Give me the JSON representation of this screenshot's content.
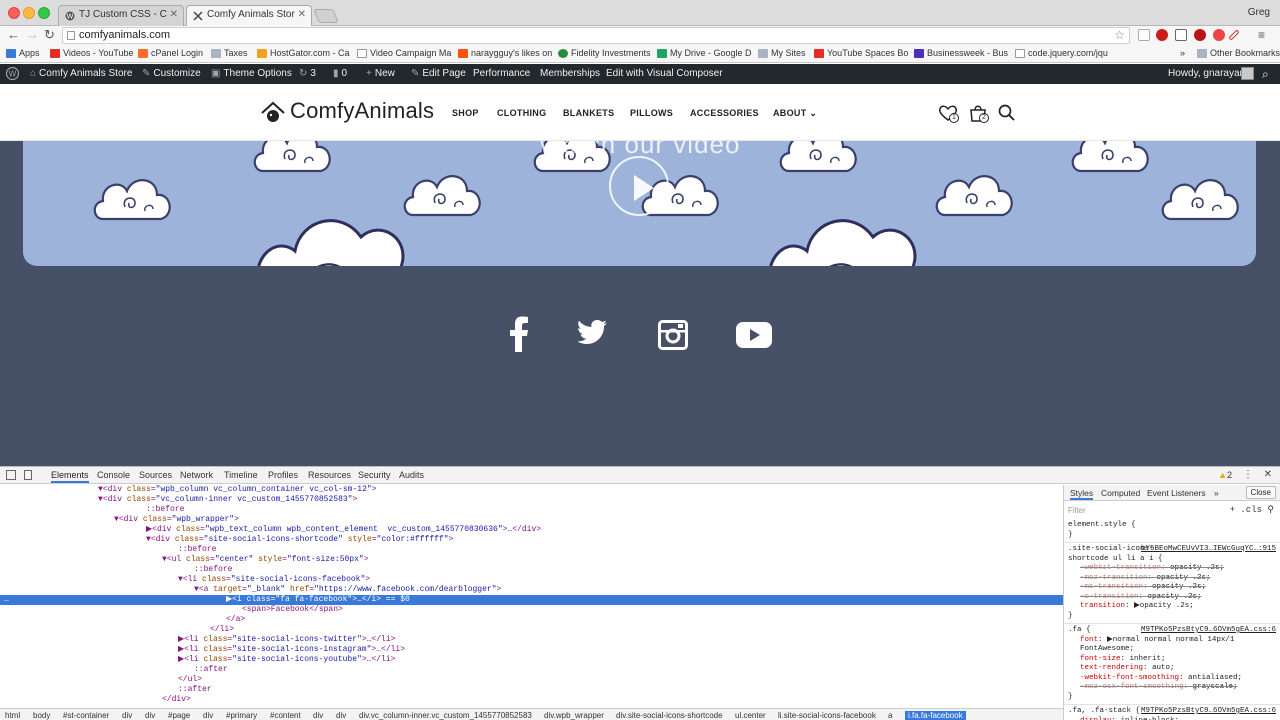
{
  "browser": {
    "tabs": [
      {
        "title": "TJ Custom CSS - Comfy A",
        "active": false
      },
      {
        "title": "Comfy Animals Store | Jus",
        "active": true
      }
    ],
    "profile": "Greg",
    "url": "comfyanimals.com",
    "bookmarks": [
      {
        "label": "Apps",
        "icon": "apps-grid-icon"
      },
      {
        "label": "Videos - YouTube",
        "icon": "youtube-icon"
      },
      {
        "label": "cPanel Login",
        "icon": "cpanel-icon"
      },
      {
        "label": "Taxes",
        "icon": "folder-icon"
      },
      {
        "label": "HostGator.com - Ca",
        "icon": "hostgator-icon"
      },
      {
        "label": "Video Campaign Ma",
        "icon": "page-icon"
      },
      {
        "label": "naraygguy's likes on",
        "icon": "soundcloud-icon"
      },
      {
        "label": "Fidelity Investments",
        "icon": "fidelity-icon"
      },
      {
        "label": "My Drive - Google D",
        "icon": "drive-icon"
      },
      {
        "label": "My Sites",
        "icon": "folder-icon"
      },
      {
        "label": "YouTube Spaces Bo",
        "icon": "youtube-icon"
      },
      {
        "label": "Businessweek - Bus",
        "icon": "businessweek-icon"
      },
      {
        "label": "code.jquery.com/jqu",
        "icon": "page-icon"
      },
      {
        "label": "Other Bookmarks",
        "icon": "folder-icon"
      }
    ],
    "chevron": "»"
  },
  "admin_bar": {
    "site_name": "Comfy Animals Store",
    "customize": "Customize",
    "theme_options": "Theme Options",
    "updates_count": "3",
    "comments_count": "0",
    "new": "New",
    "edit_page": "Edit Page",
    "performance": "Performance",
    "memberships": "Memberships",
    "visual_composer": "Edit with Visual Composer",
    "howdy": "Howdy, gnarayan"
  },
  "site": {
    "logo_text": "ComfyAnimals",
    "nav": [
      "SHOP",
      "CLOTHING",
      "BLANKETS",
      "PILLOWS",
      "ACCESSORIES",
      "ABOUT"
    ],
    "wishlist_count": "1",
    "cart_count": "2",
    "hero_caption": "Watch our video",
    "social": [
      "facebook-icon",
      "twitter-icon",
      "instagram-icon",
      "youtube-icon"
    ],
    "colors": {
      "page_bg": "#465066",
      "hero_bg": "#9eb3d9"
    }
  },
  "devtools": {
    "tabs": [
      "Elements",
      "Console",
      "Sources",
      "Network",
      "Timeline",
      "Profiles",
      "Resources",
      "Security",
      "Audits"
    ],
    "warnings": "2",
    "dom_lines": [
      {
        "indent": 24,
        "html": "▼<div class=\"wpb_column vc_column_container vc_col-sm-12\">"
      },
      {
        "indent": 24,
        "html": "▼<div class=\"vc_column-inner vc_custom_1455770852583\">"
      },
      {
        "indent": 36,
        "html": "::before"
      },
      {
        "indent": 28,
        "html": "▼<div class=\"wpb_wrapper\">"
      },
      {
        "indent": 36,
        "html": "▶<div class=\"wpb_text_column wpb_content_element  vc_custom_1455770830636\">…</div>"
      },
      {
        "indent": 36,
        "html": "▼<div class=\"site-social-icons-shortcode\" style=\"color:#ffffff\">"
      },
      {
        "indent": 44,
        "html": "::before"
      },
      {
        "indent": 40,
        "html": "▼<ul class=\"center\" style=\"font-size:50px\">"
      },
      {
        "indent": 48,
        "html": "::before"
      },
      {
        "indent": 44,
        "html": "▼<li class=\"site-social-icons-facebook\">"
      },
      {
        "indent": 48,
        "html": "▼<a target=\"_blank\" href=\"https://www.facebook.com/dearblogger\">"
      },
      {
        "indent": 56,
        "html": "▶<i class=\"fa fa-facebook\">…</i>"
      },
      {
        "indent": 60,
        "html": "<span>Facebook</span>"
      },
      {
        "indent": 56,
        "html": "</a>"
      },
      {
        "indent": 52,
        "html": "</li>"
      },
      {
        "indent": 44,
        "html": "▶<li class=\"site-social-icons-twitter\">…</li>"
      },
      {
        "indent": 44,
        "html": "▶<li class=\"site-social-icons-instagram\">…</li>"
      },
      {
        "indent": 44,
        "html": "▶<li class=\"site-social-icons-youtube\">…</li>"
      },
      {
        "indent": 48,
        "html": "::after"
      },
      {
        "indent": 44,
        "html": "</ul>"
      },
      {
        "indent": 44,
        "html": "::after"
      },
      {
        "indent": 40,
        "html": "</div>"
      },
      {
        "indent": 36,
        "html": "</div>"
      }
    ],
    "selected_line": 11,
    "selected_suffix": " == $0",
    "breadcrumbs": [
      "html",
      "body",
      "#st-container",
      "div",
      "div",
      "#page",
      "div",
      "#primary",
      "#content",
      "div",
      "div",
      "div.vc_column-inner.vc_custom_1455770852583",
      "div.wpb_wrapper",
      "div.site-social-icons-shortcode",
      "ul.center",
      "li.site-social-icons-facebook",
      "a",
      "i.fa.fa-facebook"
    ],
    "styles": {
      "tabs": [
        "Styles",
        "Computed",
        "Event Listeners",
        "»"
      ],
      "close": "Close",
      "filter_placeholder": "Filter",
      "filter_tools": "+ .cls",
      "rules": [
        {
          "selector": "element.style {",
          "source": "",
          "props": [],
          "close": "}"
        },
        {
          "selector": ".site-social-icons-shortcode ul li a i {",
          "source": "bY5BEoMwCEUvVI3…IEWcGuqYC…:915",
          "props": [
            {
              "name": "-webkit-transition",
              "value": "opacity .2s;",
              "struck": true
            },
            {
              "name": "-moz-transition",
              "value": "opacity .2s;",
              "struck": true
            },
            {
              "name": "-ms-transition",
              "value": "opacity .2s;",
              "struck": true
            },
            {
              "name": "-o-transition",
              "value": "opacity .2s;",
              "struck": true
            },
            {
              "name": "transition",
              "value": "▶opacity .2s;",
              "struck": false
            }
          ],
          "close": "}"
        },
        {
          "selector": ".fa {",
          "source": "M9TPKo5PzsBtyC9…6OVm5gEA.css:6",
          "props": [
            {
              "name": "font",
              "value": "▶normal normal normal 14px/1 FontAwesome;",
              "struck": false
            },
            {
              "name": "font-size",
              "value": "inherit;",
              "struck": false
            },
            {
              "name": "text-rendering",
              "value": "auto;",
              "struck": false
            },
            {
              "name": "-webkit-font-smoothing",
              "value": "antialiased;",
              "struck": false
            },
            {
              "name": "-moz-osx-font-smoothing",
              "value": "grayscale;",
              "struck": true
            }
          ],
          "close": "}"
        },
        {
          "selector": ".fa, .fa-stack {",
          "source": "M9TPKo5PzsBtyC9…6OVm5gEA.css:6",
          "props": [
            {
              "name": "display",
              "value": "inline-block;",
              "struck": false
            }
          ],
          "close": ""
        }
      ]
    }
  }
}
